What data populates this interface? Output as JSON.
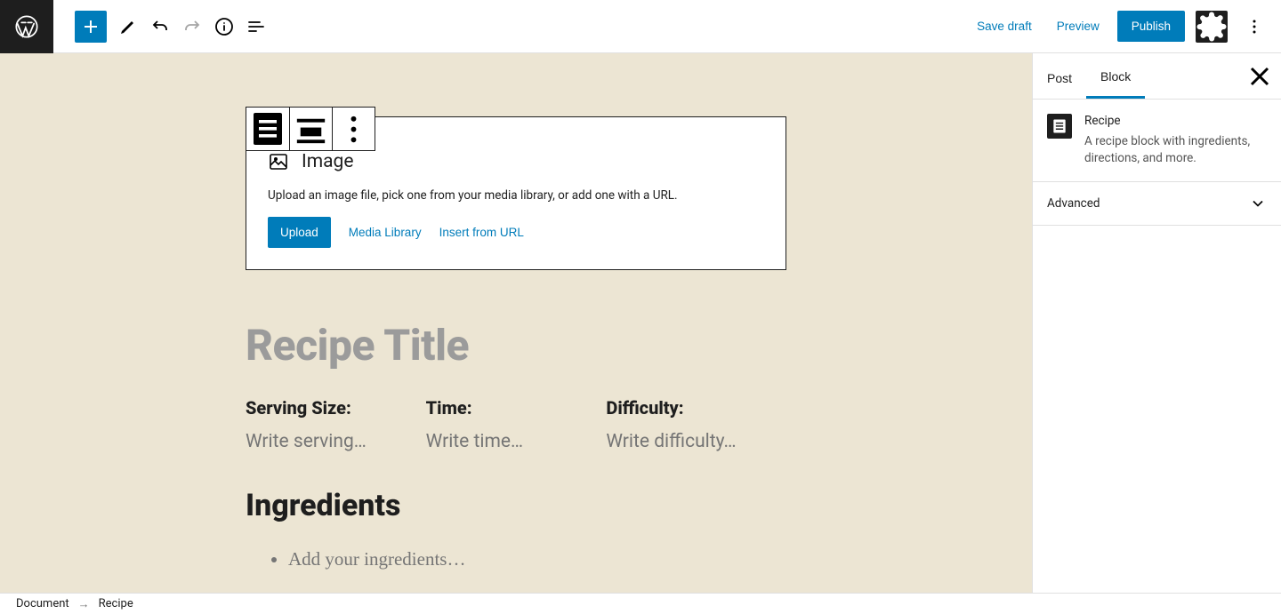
{
  "topbar": {
    "save_draft": "Save draft",
    "preview": "Preview",
    "publish": "Publish"
  },
  "image_block": {
    "title": "Image",
    "description": "Upload an image file, pick one from your media library, or add one with a URL.",
    "upload_btn": "Upload",
    "media_library_btn": "Media Library",
    "insert_url_btn": "Insert from URL"
  },
  "recipe": {
    "title_placeholder": "Recipe Title",
    "meta": {
      "serving_label": "Serving Size:",
      "serving_ph": "Write serving…",
      "time_label": "Time:",
      "time_ph": "Write time…",
      "difficulty_label": "Difficulty:",
      "difficulty_ph": "Write difficulty…"
    },
    "ingredients_heading": "Ingredients",
    "ingredients_ph": "Add your ingredients…"
  },
  "sidebar": {
    "tabs": {
      "post": "Post",
      "block": "Block"
    },
    "block_name": "Recipe",
    "block_desc": "A recipe block with ingredients, directions, and more.",
    "advanced": "Advanced"
  },
  "breadcrumb": {
    "document": "Document",
    "current": "Recipe"
  }
}
